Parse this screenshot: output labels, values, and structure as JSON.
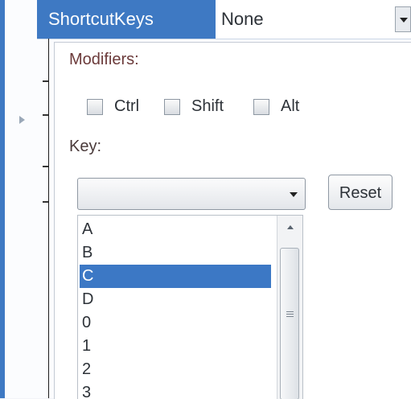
{
  "property": {
    "name": "ShortcutKeys",
    "value": "None"
  },
  "editor": {
    "modifiers_label": "Modifiers:",
    "modifiers": [
      {
        "label": "Ctrl",
        "checked": false
      },
      {
        "label": "Shift",
        "checked": false
      },
      {
        "label": "Alt",
        "checked": false
      }
    ],
    "key_label": "Key:",
    "key_value": "",
    "reset_label": "Reset",
    "key_options": [
      "A",
      "B",
      "C",
      "D",
      "0",
      "1",
      "2",
      "3"
    ],
    "selected_option": "C"
  },
  "colors": {
    "selection": "#3c78c5",
    "property_name_bg": "#3e79c3"
  }
}
